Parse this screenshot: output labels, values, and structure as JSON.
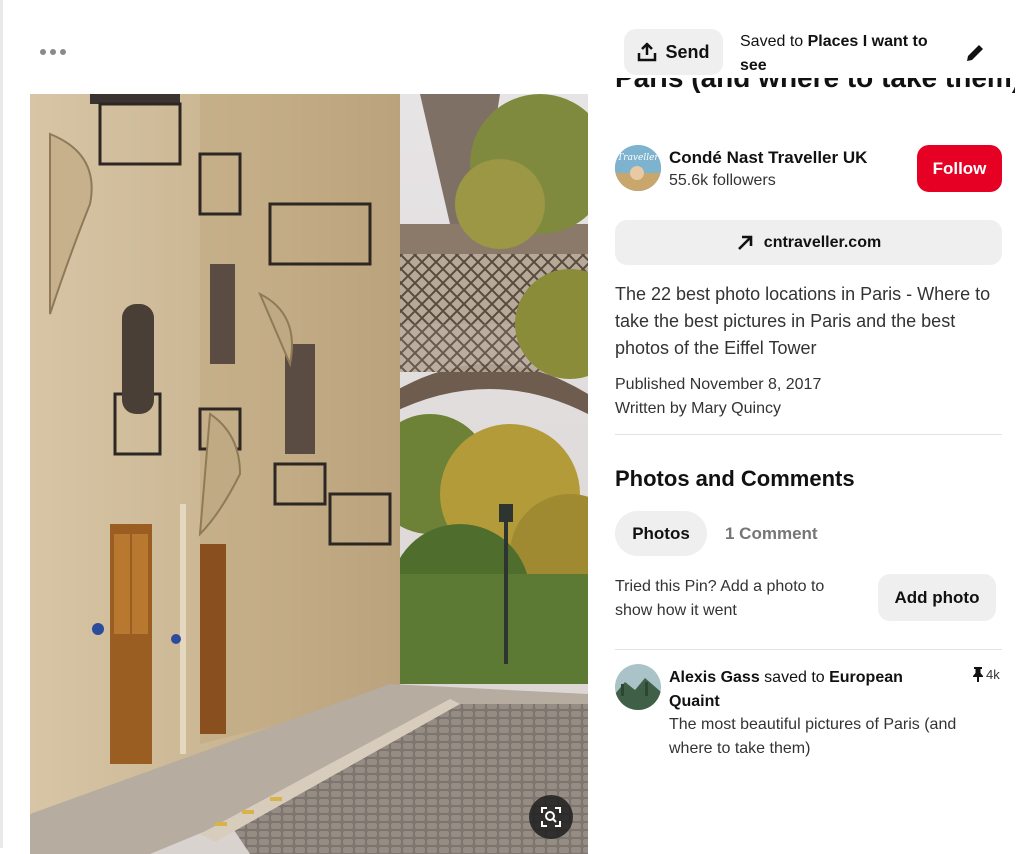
{
  "toolbar": {
    "send_label": "Send",
    "saved_prefix": "Saved to ",
    "board_name": "Places I want to see"
  },
  "pin": {
    "title": "Paris (and where to take them)",
    "creator": {
      "name": "Condé Nast Traveller UK",
      "followers": "55.6k followers",
      "follow_label": "Follow",
      "avatar_text": "Traveller"
    },
    "link": "cntraveller.com",
    "description": "The 22 best photo locations in Paris - Where to take the best pictures in Paris and the best photos of the Eiffel Tower",
    "published": "Published November 8, 2017",
    "written_by": "Written by Mary Quincy"
  },
  "comments_section": {
    "title": "Photos and Comments",
    "tabs": [
      {
        "label": "Photos"
      },
      {
        "label": "1 Comment"
      }
    ],
    "tried_prompt": "Tried this Pin? Add a photo to show how it went",
    "add_photo_label": "Add photo"
  },
  "saved_by": {
    "user": "Alexis Gass",
    "verb": " saved to ",
    "board": "European Quaint",
    "text": "The most beautiful pictures of Paris (and where to take them)",
    "count": "4k"
  },
  "colors": {
    "accent": "#e60023",
    "button_bg": "#efefef"
  },
  "icons": [
    "more-icon",
    "share-icon",
    "pencil-icon",
    "arrow-up-right-icon",
    "pin-icon",
    "lens-icon"
  ]
}
